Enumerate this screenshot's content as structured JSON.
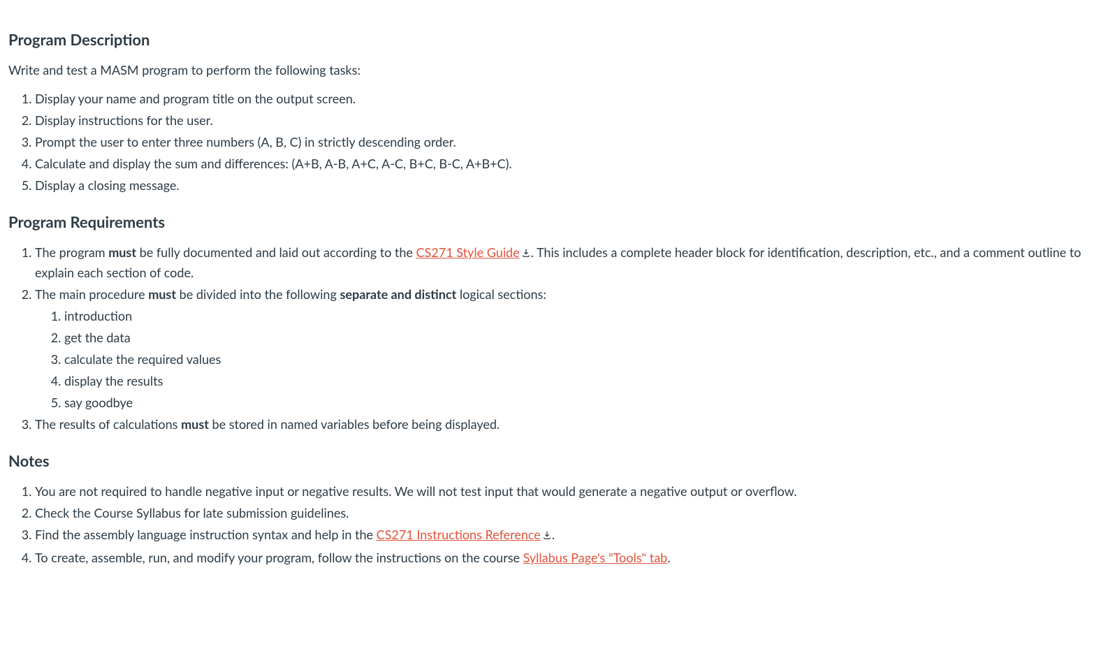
{
  "sections": {
    "description": {
      "heading": "Program Description",
      "intro": "Write and test a MASM program to perform the following tasks:",
      "items": [
        "Display your name and program title on the output screen.",
        "Display instructions for the user.",
        "Prompt the user to enter three numbers (A, B, C) in strictly descending order.",
        "Calculate and display the sum and differences: (A+B, A-B, A+C, A-C, B+C, B-C, A+B+C).",
        "Display a closing message."
      ]
    },
    "requirements": {
      "heading": "Program Requirements",
      "item1": {
        "pre": "The program ",
        "bold": "must",
        "mid": " be fully documented and laid out according to the ",
        "link": "CS271 Style Guide",
        "post": ". This includes a complete header block for identification, description, etc., and a comment outline to explain each section of code."
      },
      "item2": {
        "pre": "The main procedure ",
        "bold1": "must",
        "mid": " be divided into the following ",
        "bold2": "separate and distinct",
        "post": " logical sections:",
        "sub": [
          "introduction",
          "get the data",
          "calculate the required values",
          "display the results",
          "say goodbye"
        ]
      },
      "item3": {
        "pre": "The results of calculations ",
        "bold": "must",
        "post": " be stored in named variables before being displayed."
      }
    },
    "notes": {
      "heading": "Notes",
      "item1": "You are not required to handle negative input or negative results. We will not test input that would generate a negative output or overflow.",
      "item2": "Check the Course Syllabus for late submission guidelines.",
      "item3": {
        "pre": "Find the assembly language instruction syntax and help in the ",
        "link": "CS271 Instructions Reference",
        "post": "."
      },
      "item4": {
        "pre": "To create, assemble, run,  and modify your program, follow the instructions on the course ",
        "link": "Syllabus Page's \"Tools\" tab",
        "post": "."
      }
    }
  }
}
